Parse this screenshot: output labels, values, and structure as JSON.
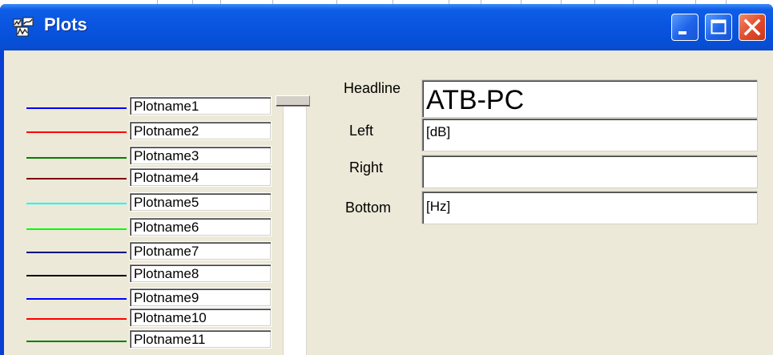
{
  "window": {
    "title": "Plots",
    "icon": "plots-app-icon",
    "controls": {
      "minimize": "minimize-icon",
      "maximize": "maximize-icon",
      "close": "close-icon"
    },
    "colors": {
      "titlebar": "#0a55e0",
      "client": "#ece9d8",
      "close": "#e0492a"
    }
  },
  "plots": [
    {
      "name": "Plotname1",
      "color": "#0000ff"
    },
    {
      "name": "Plotname2",
      "color": "#ff0000"
    },
    {
      "name": "Plotname3",
      "color": "#008000"
    },
    {
      "name": "Plotname4",
      "color": "#800000"
    },
    {
      "name": "Plotname5",
      "color": "#00ffff"
    },
    {
      "name": "Plotname6",
      "color": "#00ff00"
    },
    {
      "name": "Plotname7",
      "color": "#000080"
    },
    {
      "name": "Plotname8",
      "color": "#000000"
    },
    {
      "name": "Plotname9",
      "color": "#0000ff"
    },
    {
      "name": "Plotname10",
      "color": "#ff0000"
    },
    {
      "name": "Plotname11",
      "color": "#008000"
    }
  ],
  "fields": {
    "headline": {
      "label": "Headline",
      "value": "ATB-PC"
    },
    "left": {
      "label": "Left",
      "value": "[dB]"
    },
    "right": {
      "label": "Right",
      "value": ""
    },
    "bottom": {
      "label": "Bottom",
      "value": "[Hz]"
    }
  }
}
